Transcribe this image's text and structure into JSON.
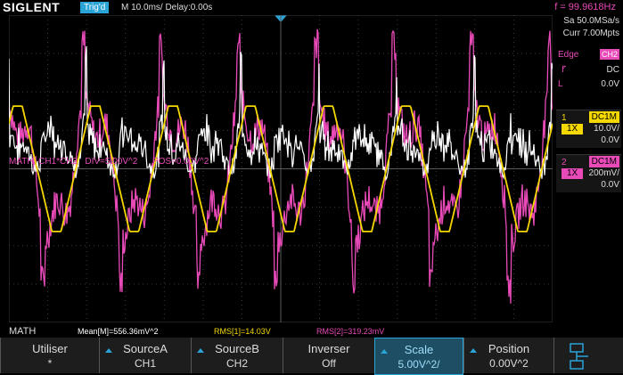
{
  "header": {
    "brand": "SIGLENT",
    "trig_state": "Trig'd",
    "timebase": "M 10.0ms/ Delay:0.00s",
    "trigger_frequency": "f = 99.9618Hz"
  },
  "right_panel": {
    "sample_rate": "Sa 50.0MSa/s",
    "memory": "Curr 7.00Mpts",
    "trigger": {
      "type_label": "Edge",
      "source": "CH2",
      "coupling": "DC",
      "level_label": "L",
      "level": "0.0V"
    },
    "channels": [
      {
        "num": "1",
        "coupling": "DC1M",
        "probe": "1X",
        "scale": "10.0V/",
        "offset": "0.0V",
        "color": "#f5d800"
      },
      {
        "num": "2",
        "coupling": "DC1M",
        "probe": "1X",
        "scale": "200mV/",
        "offset": "0.0V",
        "color": "#e84ab8"
      }
    ]
  },
  "math_overlay": "MATH  CH1*CH2   DIV=5.00V^2      POS=0.00V^2",
  "status": {
    "label": "MATH",
    "mean": "Mean[M]=556.36mV^2",
    "rms1": "RMS[1]=14.03V",
    "rms2": "RMS[2]=319.23mV"
  },
  "softkeys": [
    {
      "title": "Utiliser",
      "value": "*"
    },
    {
      "title": "SourceA",
      "value": "CH1"
    },
    {
      "title": "SourceB",
      "value": "CH2"
    },
    {
      "title": "Inverser",
      "value": "Off"
    },
    {
      "title": "Scale",
      "value": "5.00V^2/"
    },
    {
      "title": "Position",
      "value": "0.00V^2"
    }
  ],
  "colors": {
    "ch1": "#f5d800",
    "ch2": "#e84ab8",
    "math": "#ffffff",
    "accent": "#2aa3d6"
  },
  "icons": [
    "trigger-marker-icon",
    "rising-edge-icon",
    "network-icon",
    "up-arrow-icon"
  ]
}
